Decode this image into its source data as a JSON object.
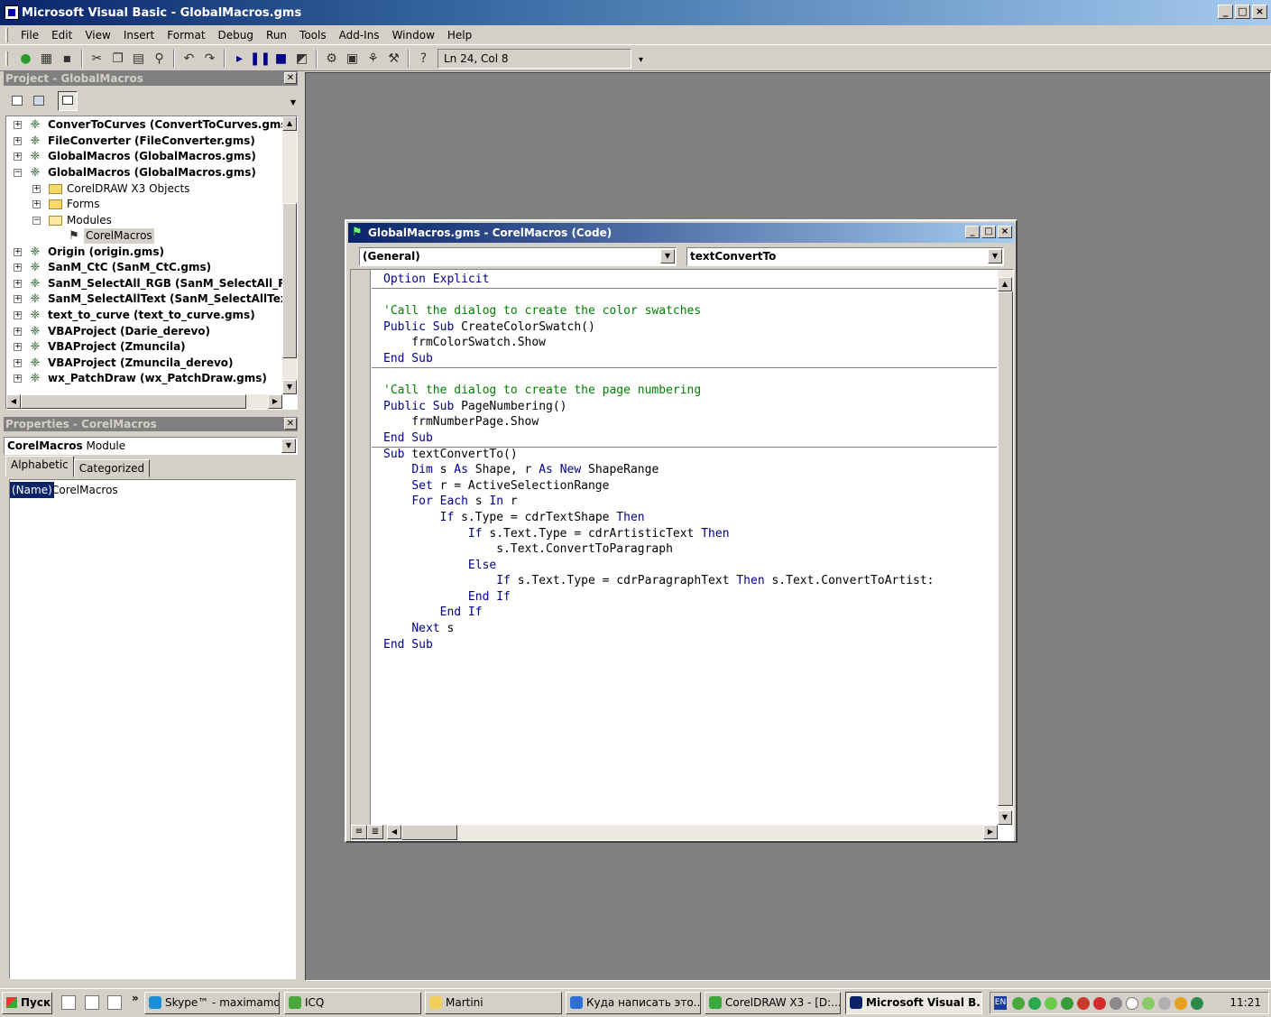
{
  "window": {
    "title": "Microsoft Visual Basic - GlobalMacros.gms"
  },
  "menu": [
    "File",
    "Edit",
    "View",
    "Insert",
    "Format",
    "Debug",
    "Run",
    "Tools",
    "Add-Ins",
    "Window",
    "Help"
  ],
  "toolbar": {
    "position": "Ln 24, Col 8"
  },
  "project": {
    "title": "Project - GlobalMacros",
    "items": [
      "ConverToCurves (ConvertToCurves.gms)",
      "FileConverter (FileConverter.gms)",
      "GlobalMacros (GlobalMacros.gms)",
      "GlobalMacros (GlobalMacros.gms)",
      "CorelDRAW X3 Objects",
      "Forms",
      "Modules",
      "CorelMacros",
      "Origin (origin.gms)",
      "SanM_CtC (SanM_CtC.gms)",
      "SanM_SelectAll_RGB (SanM_SelectAll_RG",
      "SanM_SelectAllText (SanM_SelectAllText",
      "text_to_curve (text_to_curve.gms)",
      "VBAProject (Darie_derevo)",
      "VBAProject (Zmuncila)",
      "VBAProject (Zmuncila_derevo)",
      "wx_PatchDraw (wx_PatchDraw.gms)"
    ]
  },
  "properties": {
    "title": "Properties - CorelMacros",
    "object_name": "CorelMacros",
    "object_type": "Module",
    "tab_alphabetic": "Alphabetic",
    "tab_categorized": "Categorized",
    "prop_name": "(Name)",
    "prop_value": "CorelMacros"
  },
  "code_window": {
    "title": "GlobalMacros.gms - CorelMacros (Code)",
    "object_combo": "(General)",
    "proc_combo": "textConvertTo",
    "lines": [
      [
        {
          "t": "Option Explicit",
          "c": "kw"
        }
      ],
      [],
      [
        {
          "t": "'Call the dialog to create the color swatches",
          "c": "cm"
        }
      ],
      [
        {
          "t": "Public Sub",
          "c": "kw"
        },
        {
          "t": " CreateColorSwatch()"
        }
      ],
      [
        {
          "t": "    frmColorSwatch.Show"
        }
      ],
      [
        {
          "t": "End Sub",
          "c": "kw"
        }
      ],
      [],
      [
        {
          "t": "'Call the dialog to create the page numbering",
          "c": "cm"
        }
      ],
      [
        {
          "t": "Public Sub",
          "c": "kw"
        },
        {
          "t": " PageNumbering()"
        }
      ],
      [
        {
          "t": "    frmNumberPage.Show"
        }
      ],
      [
        {
          "t": "End Sub",
          "c": "kw"
        }
      ],
      [
        {
          "t": "Sub",
          "c": "kw"
        },
        {
          "t": " textConvertTo()"
        }
      ],
      [
        {
          "t": "    "
        },
        {
          "t": "Dim",
          "c": "kw"
        },
        {
          "t": " s "
        },
        {
          "t": "As",
          "c": "kw"
        },
        {
          "t": " Shape, r "
        },
        {
          "t": "As New",
          "c": "kw"
        },
        {
          "t": " ShapeRange"
        }
      ],
      [
        {
          "t": "    "
        },
        {
          "t": "Set",
          "c": "kw"
        },
        {
          "t": " r = ActiveSelectionRange"
        }
      ],
      [
        {
          "t": "    "
        },
        {
          "t": "For Each",
          "c": "kw"
        },
        {
          "t": " s "
        },
        {
          "t": "In",
          "c": "kw"
        },
        {
          "t": " r"
        }
      ],
      [
        {
          "t": "        "
        },
        {
          "t": "If",
          "c": "kw"
        },
        {
          "t": " s.Type = cdrTextShape "
        },
        {
          "t": "Then",
          "c": "kw"
        }
      ],
      [
        {
          "t": "            "
        },
        {
          "t": "If",
          "c": "kw"
        },
        {
          "t": " s.Text.Type = cdrArtisticText "
        },
        {
          "t": "Then",
          "c": "kw"
        }
      ],
      [
        {
          "t": "                s.Text.ConvertToParagraph"
        }
      ],
      [
        {
          "t": "            "
        },
        {
          "t": "Else",
          "c": "kw"
        }
      ],
      [
        {
          "t": "                "
        },
        {
          "t": "If",
          "c": "kw"
        },
        {
          "t": " s.Text.Type = cdrParagraphText "
        },
        {
          "t": "Then",
          "c": "kw"
        },
        {
          "t": " s.Text.ConvertToArtist:"
        }
      ],
      [
        {
          "t": "            "
        },
        {
          "t": "End If",
          "c": "kw"
        }
      ],
      [
        {
          "t": "        "
        },
        {
          "t": "End If",
          "c": "kw"
        }
      ],
      [
        {
          "t": "    "
        },
        {
          "t": "Next",
          "c": "kw"
        },
        {
          "t": " s"
        }
      ],
      [
        {
          "t": "End Sub",
          "c": "kw"
        }
      ]
    ]
  },
  "taskbar": {
    "start": "Пуск",
    "tasks": [
      "Skype™ - maximamd",
      "ICQ",
      "Martini",
      "Куда написать это...",
      "CorelDRAW X3 - [D:...",
      "Microsoft Visual B..."
    ],
    "lang": "EN",
    "clock": "11:21"
  },
  "colors": {
    "keyword": "#00008b",
    "comment": "#008000",
    "titlebar": "#0a246a",
    "workspace": "#808080"
  }
}
